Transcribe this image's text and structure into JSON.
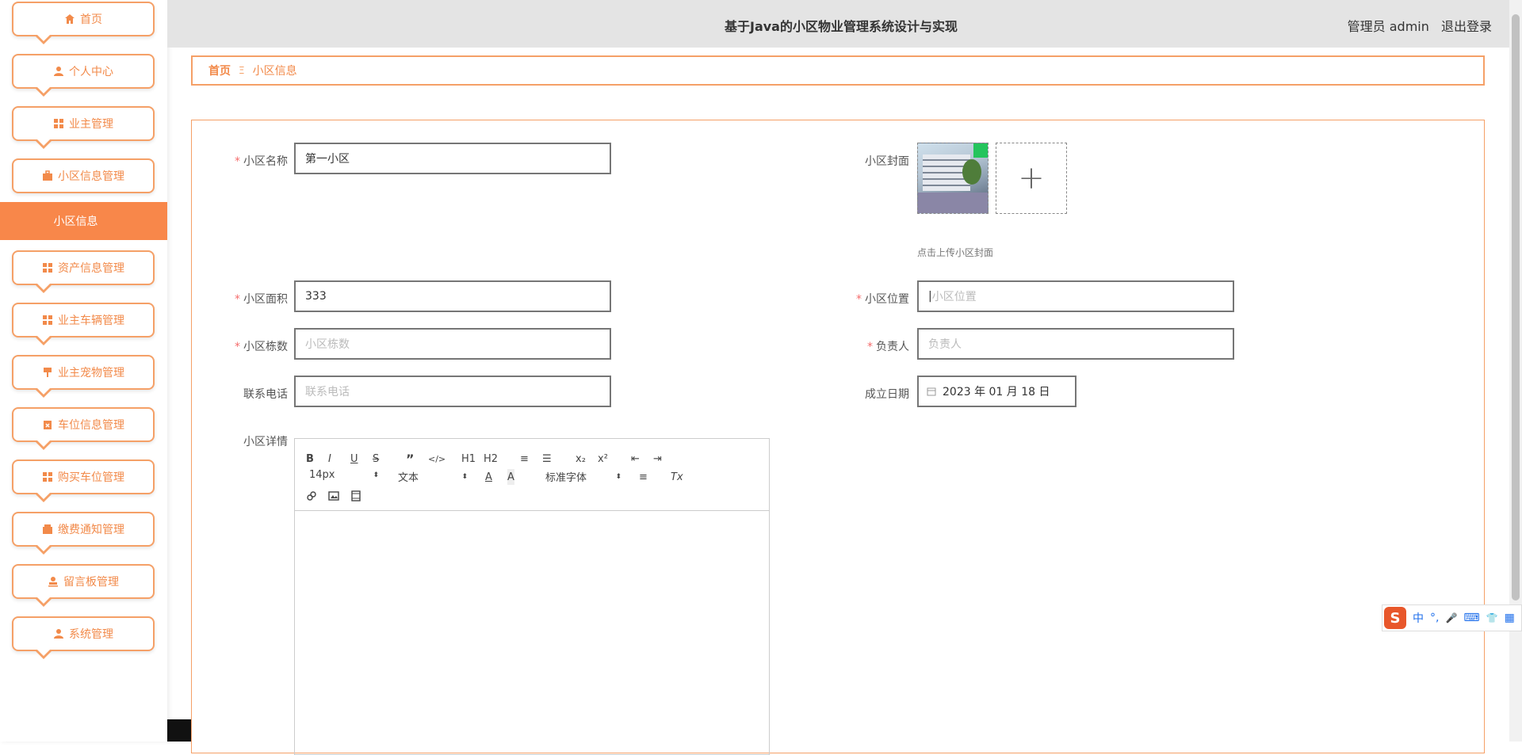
{
  "header": {
    "title": "基于Java的小区物业管理系统设计与实现",
    "user_label": "管理员 admin",
    "logout_label": "退出登录"
  },
  "sidebar": {
    "items": [
      {
        "label": "首页",
        "icon": "home-icon"
      },
      {
        "label": "个人中心",
        "icon": "user-icon"
      },
      {
        "label": "业主管理",
        "icon": "grid-icon"
      },
      {
        "label": "小区信息管理",
        "icon": "briefcase-icon"
      },
      {
        "label": "资产信息管理",
        "icon": "grid-icon"
      },
      {
        "label": "业主车辆管理",
        "icon": "grid-icon"
      },
      {
        "label": "业主宠物管理",
        "icon": "flag-icon"
      },
      {
        "label": "车位信息管理",
        "icon": "clipboard-icon"
      },
      {
        "label": "购买车位管理",
        "icon": "grid-icon"
      },
      {
        "label": "缴费通知管理",
        "icon": "wallet-icon"
      },
      {
        "label": "留言板管理",
        "icon": "stamp-icon"
      },
      {
        "label": "系统管理",
        "icon": "user-icon"
      }
    ],
    "active_sub": "小区信息"
  },
  "breadcrumb": {
    "home": "首页",
    "separator": "Ξ",
    "current": "小区信息"
  },
  "form": {
    "name": {
      "label": "小区名称",
      "value": "第一小区"
    },
    "cover": {
      "label": "小区封面",
      "tip": "点击上传小区封面",
      "add": "+"
    },
    "area": {
      "label": "小区面积",
      "value": "333"
    },
    "location": {
      "label": "小区位置",
      "placeholder": "小区位置"
    },
    "buildings": {
      "label": "小区栋数",
      "placeholder": "小区栋数"
    },
    "manager": {
      "label": "负责人",
      "placeholder": "负责人"
    },
    "phone": {
      "label": "联系电话",
      "placeholder": "联系电话"
    },
    "date": {
      "label": "成立日期",
      "value": "2023 年 01 月 18 日"
    },
    "details": {
      "label": "小区详情"
    }
  },
  "editor": {
    "row1": [
      "B",
      "I",
      "U",
      "S",
      "”",
      "</>",
      "H1",
      "H2",
      "≡",
      "☰",
      "x₂",
      "x²",
      "⇤",
      "⇥"
    ],
    "font_size": "14px",
    "header_select": "文本",
    "color_btn": "A",
    "bg_btn": "A",
    "font_select": "标准字体",
    "align_btn": "≡",
    "clear_btn": "Tx"
  },
  "ime": {
    "logo": "S",
    "items": [
      "中",
      "°,",
      "🎤",
      "⌨",
      "👕",
      "▦"
    ]
  },
  "colors": {
    "accent": "#f8874a",
    "border": "#f5a067",
    "header_bg": "#e4e4e4"
  }
}
